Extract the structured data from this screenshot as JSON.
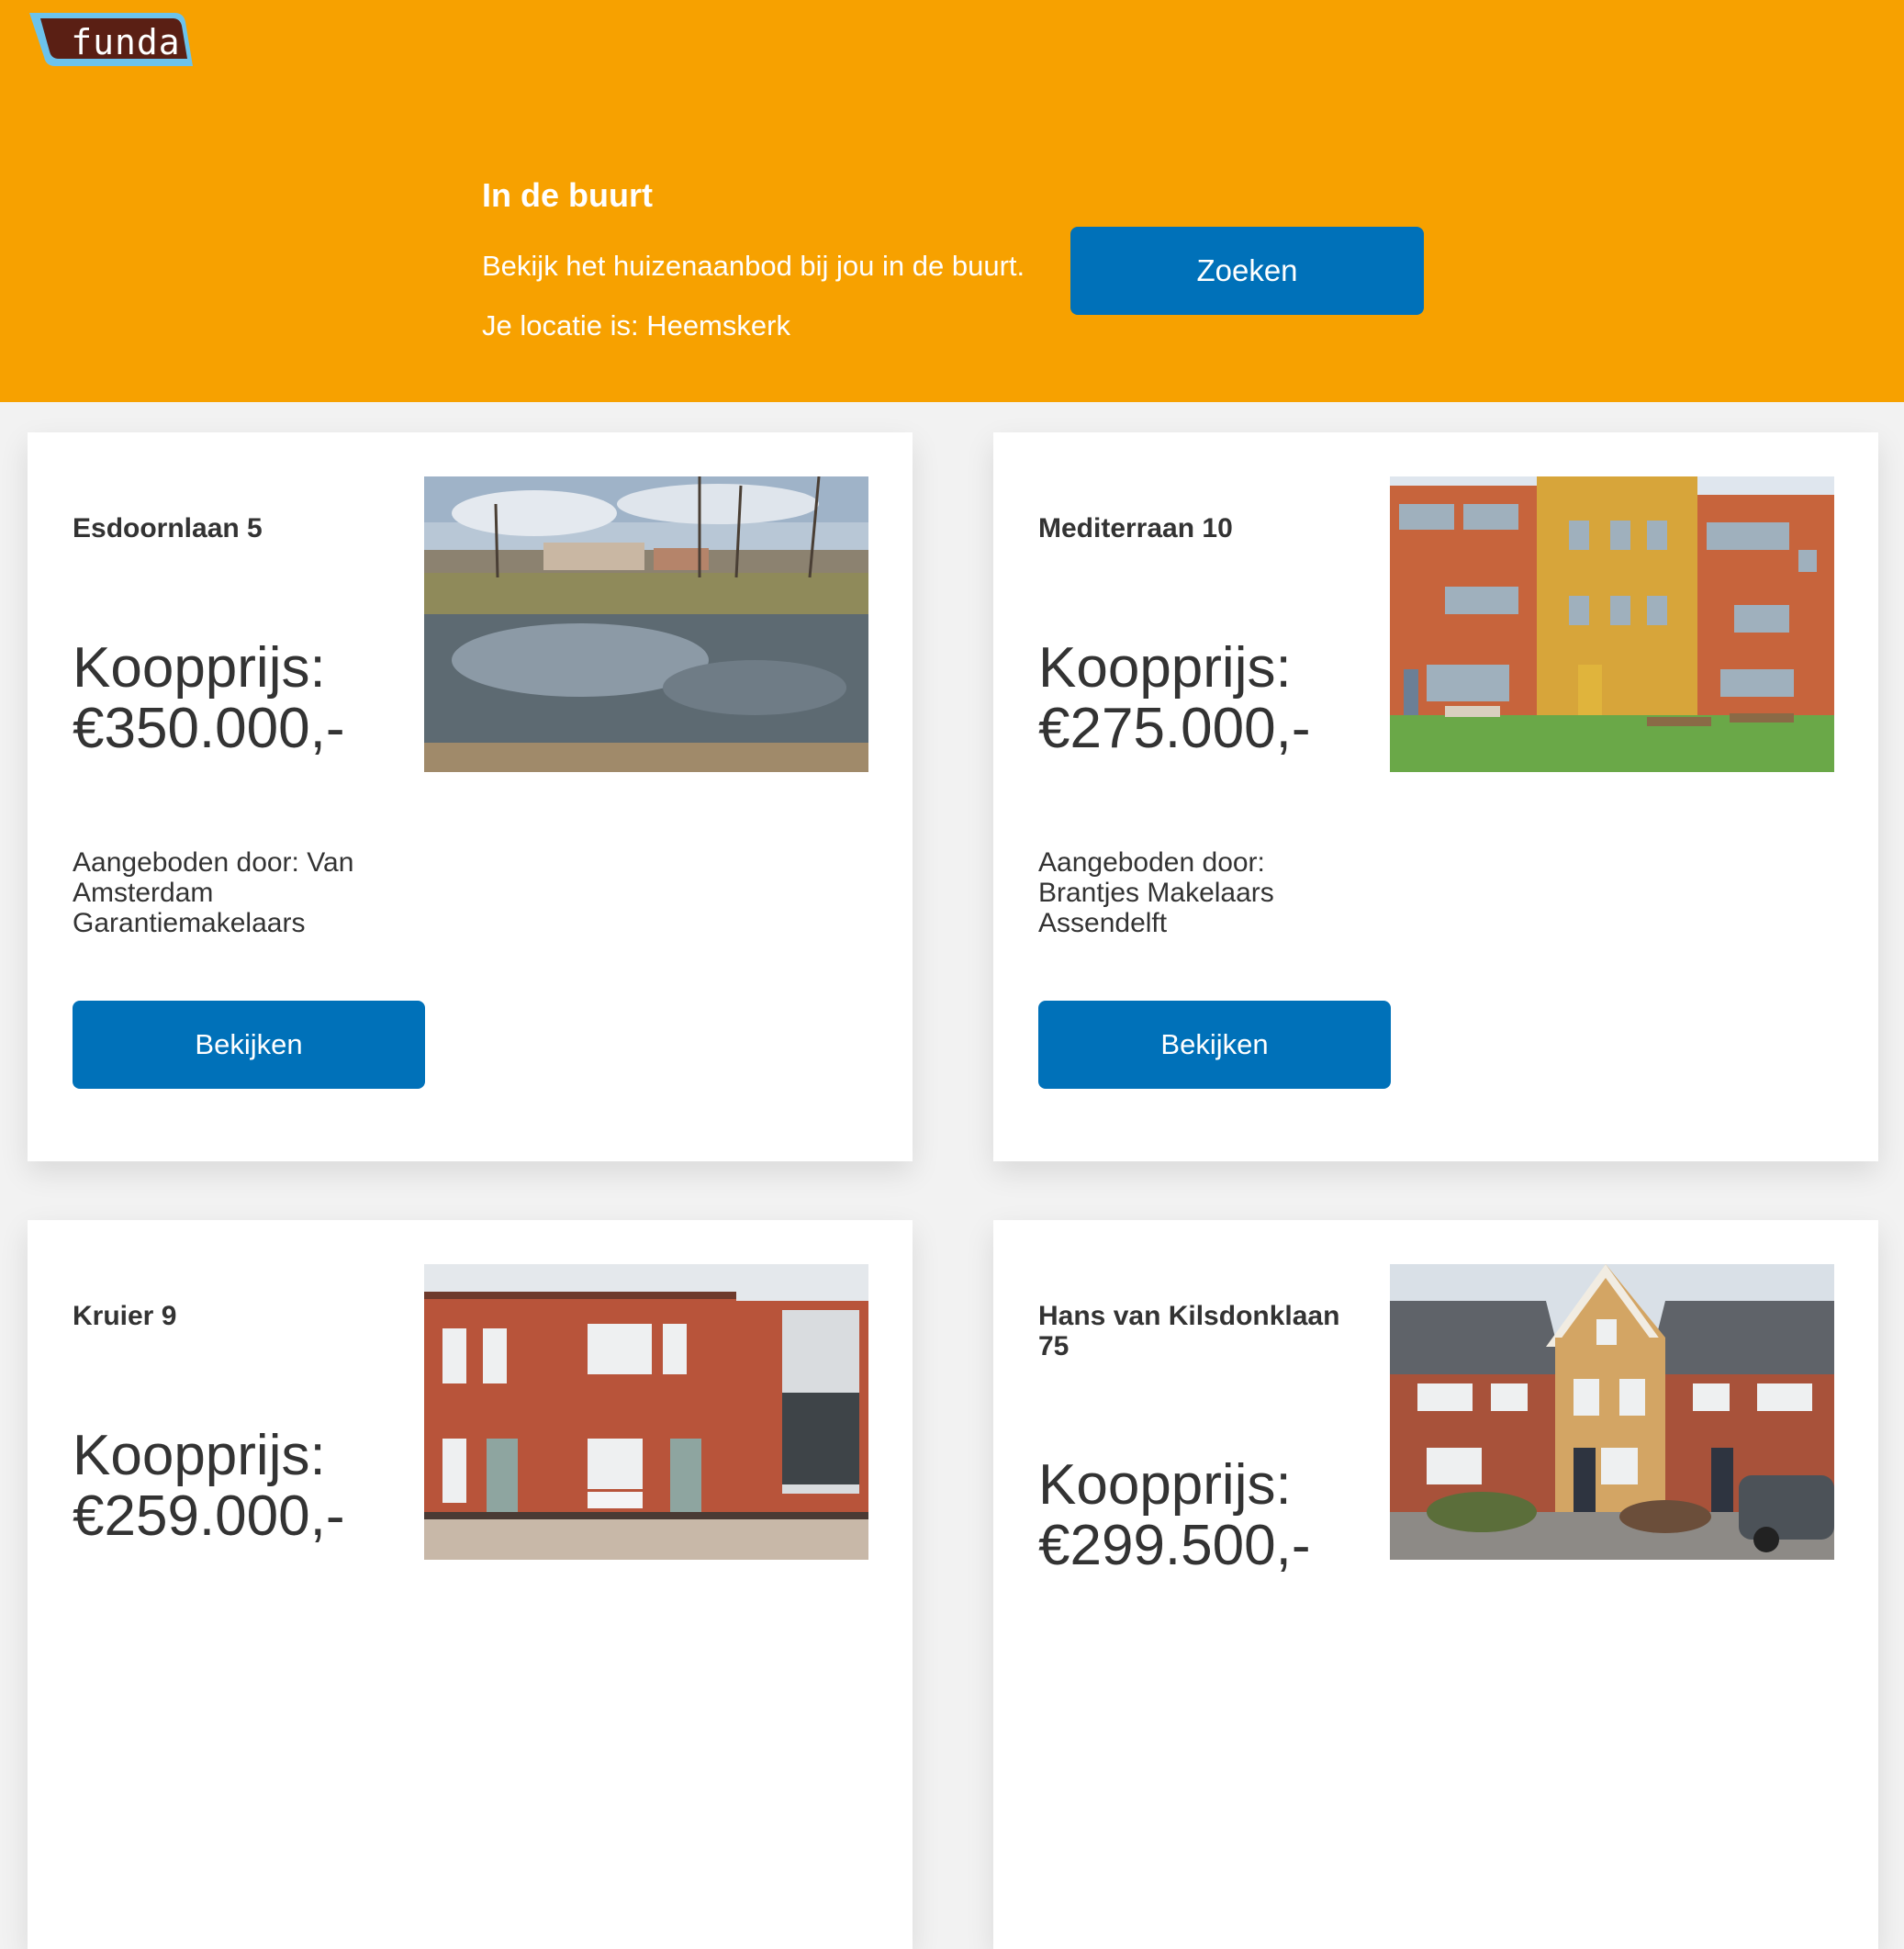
{
  "header": {
    "logo_text": "funda",
    "title": "In de buurt",
    "subtitle": "Bekijk het huizenaanbod bij jou in de buurt.",
    "location": "Je locatie is: Heemskerk",
    "search_label": "Zoeken"
  },
  "listings": [
    {
      "street": "Esdoornlaan 5",
      "price": "Koopprijs: €350.000,-",
      "agent": "Aangeboden door: Van Amsterdam Garantiemakelaars",
      "button_label": "Bekijken",
      "photo": "canal-landscape-photo"
    },
    {
      "street": "Mediterraan 10",
      "price": "Koopprijs: €275.000,-",
      "agent": "Aangeboden door: Brantjes Makelaars Assendelft",
      "button_label": "Bekijken",
      "photo": "terraced-houses-photo"
    },
    {
      "street": "Kruier 9",
      "price": "Koopprijs: €259.000,-",
      "photo": "brick-house-photo"
    },
    {
      "street": "Hans van Kilsdonklaan 75",
      "price": "Koopprijs: €299.500,-",
      "photo": "gabled-house-photo"
    }
  ],
  "colors": {
    "header_bg": "#f7a100",
    "button_bg": "#0071b9",
    "logo_bg": "#5a1f14",
    "logo_border": "#6cc3ec"
  }
}
